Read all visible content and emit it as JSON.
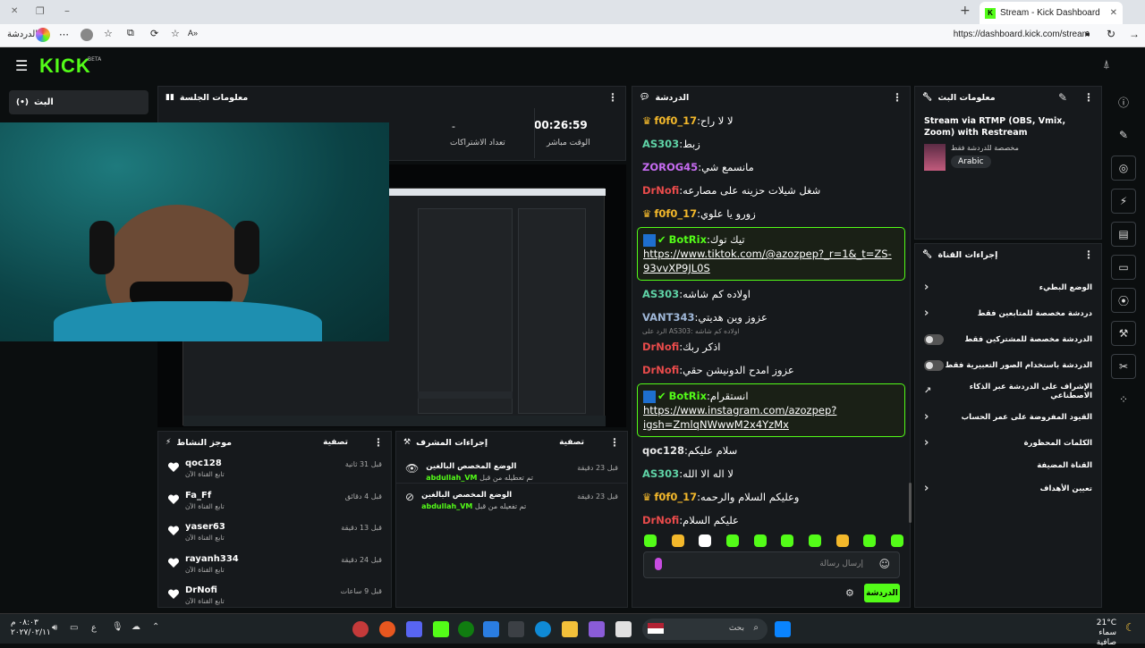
{
  "browser": {
    "tab_title": "Stream - Kick Dashboard",
    "url": "https://dashboard.kick.com/stream",
    "left_label": "الدردشة",
    "tab_icon": "KICK logo K"
  },
  "header": {
    "logo": "KICK",
    "beta": "BETA"
  },
  "nav": {
    "live_label": "البث",
    "live_icon": "broadcast-icon"
  },
  "session": {
    "title": "معلومات الجلسة",
    "uptime_value": "00:26:59",
    "uptime_label": "الوقت مباشر",
    "subs_value": "-",
    "subs_label": "تعداد الاشتراكات"
  },
  "activity": {
    "title": "موجز النشاط",
    "filter": "تصفية",
    "items": [
      {
        "user": "qoc128",
        "desc": "تابع القناة الآن",
        "ago": "قبل 31 ثانية"
      },
      {
        "user": "Fa_Ff",
        "desc": "تابع القناة الآن",
        "ago": "قبل 4 دقائق"
      },
      {
        "user": "yaser63",
        "desc": "تابع القناة الآن",
        "ago": "قبل 13 دقيقة"
      },
      {
        "user": "rayanh334",
        "desc": "تابع القناة الآن",
        "ago": "قبل 24 دقيقة"
      },
      {
        "user": "DrNofi",
        "desc": "تابع القناة الآن",
        "ago": "قبل 9 ساعات"
      }
    ]
  },
  "mod_actions": {
    "title": "إجراءات المشرف",
    "filter": "تصفية",
    "items": [
      {
        "title": "الوضع المخصص البالغين",
        "by_label": "تم تعطيله من قبل",
        "by_user": "abdullah_VM",
        "ago": "قبل 23 دقيقة"
      },
      {
        "title": "الوضع المخصص البالغين",
        "by_label": "تم تفعيله من قبل",
        "by_user": "abdullah_VM",
        "ago": "قبل 23 دقيقة"
      }
    ]
  },
  "chat": {
    "title": "الدردشة",
    "input_placeholder": "إرسال رسالة",
    "send_label": "الدردشة",
    "reply_hint": "الرد على AS303: اولاده كم شاشه",
    "messages": [
      {
        "user": "f0f0_17",
        "color": "#f3b82b",
        "text": "لا لا راح",
        "badge": "crown"
      },
      {
        "user": "AS303",
        "color": "#5fd3a6",
        "text": "زبط",
        "badge": ""
      },
      {
        "user": "ZOROG45",
        "color": "#c76cf2",
        "text": "مانسمع شي",
        "badge": ""
      },
      {
        "user": "DrNofi",
        "color": "#e94b4b",
        "text": "شغل شيلات حزينه على مصارعه",
        "badge": ""
      },
      {
        "user": "f0f0_17",
        "color": "#f3b82b",
        "text": "زورو يا علوي",
        "badge": "crown"
      },
      {
        "user": "BotRix",
        "color": "#53fc18",
        "text": "تيك توك",
        "link": "https://www.tiktok.com/@azozpep?_r=1&_t=ZS-93vvXP9JL0S",
        "badge": "bot"
      },
      {
        "user": "AS303",
        "color": "#5fd3a6",
        "text": "اولاده كم شاشه",
        "badge": ""
      },
      {
        "user": "VANT343",
        "color": "#9fb7d8",
        "text": "عزوز وين هديتي",
        "badge": ""
      },
      {
        "user": "DrNofi",
        "color": "#e94b4b",
        "text": "اذكر ربك",
        "badge": "",
        "reply": true
      },
      {
        "user": "DrNofi",
        "color": "#e94b4b",
        "text": "عزوز امدح الدونيشن حقي",
        "badge": ""
      },
      {
        "user": "BotRix",
        "color": "#53fc18",
        "text": "انستقرام",
        "link": "https://www.instagram.com/azozpep?igsh=ZmlqNWwwM2x4YzMx",
        "badge": "bot"
      },
      {
        "user": "qoc128",
        "color": "#e6e6e6",
        "text": "سلام عليكم",
        "badge": ""
      },
      {
        "user": "AS303",
        "color": "#5fd3a6",
        "text": "لا اله الا الله",
        "badge": ""
      },
      {
        "user": "f0f0_17",
        "color": "#f3b82b",
        "text": "وعليكم السلام والرحمه",
        "badge": "crown"
      },
      {
        "user": "DrNofi",
        "color": "#e94b4b",
        "text": "عليكم السلام",
        "badge": ""
      }
    ]
  },
  "stream_info": {
    "title": "معلومات البث",
    "stream_title": "Stream via RTMP (OBS, Vmix, Zoom) with Restream",
    "category": "مخصصة للدردشة فقط",
    "language": "Arabic"
  },
  "channel_actions": {
    "title": "إجراءات القناة",
    "items": [
      {
        "label": "الوضع البطيء",
        "control": "chevron"
      },
      {
        "label": "دردشة مخصصة للمتابعين فقط",
        "control": "chevron"
      },
      {
        "label": "الدردشة مخصصة للمشتركين فقط",
        "control": "toggle"
      },
      {
        "label": "الدردشة باستخدام الصور التعبيرية فقط",
        "control": "toggle"
      },
      {
        "label": "الإشراف على الدردشة عبر الذكاء الاصطناعي",
        "control": "external"
      },
      {
        "label": "القيود المفروضة على عمر الحساب",
        "control": "chevron"
      },
      {
        "label": "الكلمات المحظورة",
        "control": "chevron"
      }
    ],
    "host_heading": "القناة المضيفة",
    "host_item": "تعيين الأهداف"
  },
  "taskbar": {
    "search_label": "بحث",
    "weather_temp": "21°C",
    "weather_desc": "سماء صافية",
    "time": "٠٨:٠٣ م",
    "date": "٢٠٢٧/٠٢/١١",
    "lang": "ع"
  },
  "colors": {
    "accent": "#53fc18",
    "panel": "#16191c",
    "background": "#0b0e0f"
  }
}
